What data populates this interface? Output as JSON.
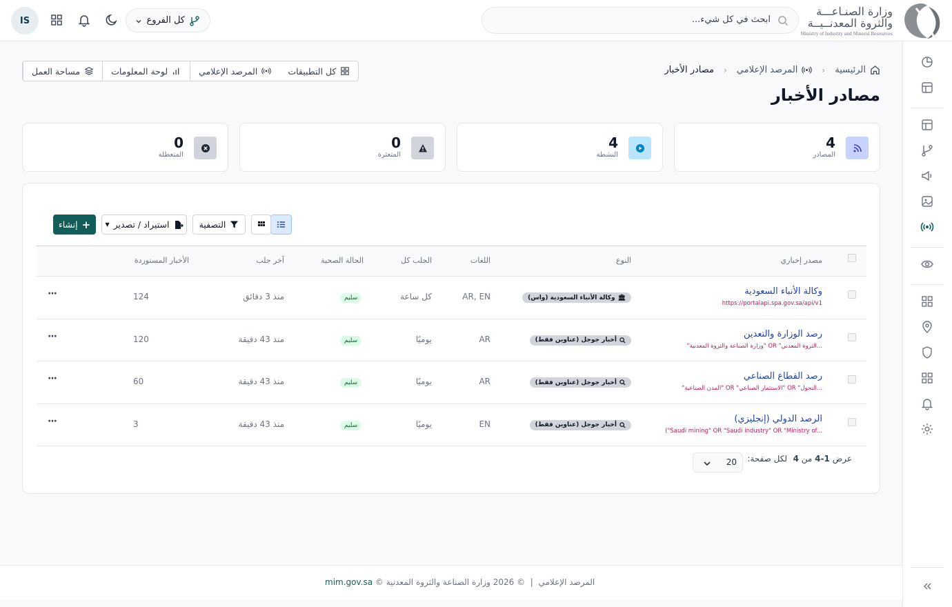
{
  "header": {
    "logo_line1": "وزارة الصنـاعـــة",
    "logo_line2": "والثروة المعدنــيــة",
    "logo_en": "Ministry of Industry and Mineral Resources",
    "search_placeholder": "ابحث في كل شيء...",
    "branch_label": "كل الفروع",
    "avatar_initials": "IS"
  },
  "breadcrumb": {
    "home": "الرئيسية",
    "section": "المرصد الإعلامي",
    "current": "مصادر الأخبار"
  },
  "page_title": "مصادر الأخبار",
  "app_nav": {
    "all_apps": "كل التطبيقات",
    "media_monitor": "المرصد الإعلامي",
    "dashboard": "لوحة المعلومات",
    "workspace": "مساحة العمل"
  },
  "stats": [
    {
      "value": "4",
      "label": "المصادر",
      "color": "#c7d2fe"
    },
    {
      "value": "4",
      "label": "النشطة",
      "color": "#bae6fd"
    },
    {
      "value": "0",
      "label": "المتعثرة",
      "color": "#d1d5db"
    },
    {
      "value": "0",
      "label": "المتعطلة",
      "color": "#d1d5db"
    }
  ],
  "toolbar": {
    "create": "إنشاء",
    "import_export": "استيراد / تصدير",
    "filter": "التصفية"
  },
  "table": {
    "headers": {
      "source": "مصدر إخباري",
      "type": "النوع",
      "languages": "اللغات",
      "fetch_every": "الجلب كل",
      "health": "الحالة الصحية",
      "last_fetch": "آخر جلب",
      "imported": "الأخبار المستوردة"
    },
    "rows": [
      {
        "name": "وكالة الأنباء السعودية",
        "sub": "https://portalapi.spa.gov.sa/api/v1",
        "type": "وكالة الأنباء السعودية (واس)",
        "langs": "AR, EN",
        "every": "كل ساعة",
        "health": "سليم",
        "last": "منذ 3 دقائق",
        "count": "124"
      },
      {
        "name": "رصد الوزارة والتعدين",
        "sub": "\"وزارة الصناعة والثروة المعدنية\" OR \"الثروة المعدني...",
        "type": "أخبار جوجل (عناوين فقط)",
        "langs": "AR",
        "every": "يوميًا",
        "health": "سليم",
        "last": "منذ 43 دقيقة",
        "count": "120"
      },
      {
        "name": "رصد القطاع الصناعي",
        "sub": "\"المدن الصناعية\" OR \"الاستثمار الصناعي\" OR \"التحول...",
        "type": "أخبار جوجل (عناوين فقط)",
        "langs": "AR",
        "every": "يوميًا",
        "health": "سليم",
        "last": "منذ 43 دقيقة",
        "count": "60"
      },
      {
        "name": "الرصد الدولي (إنجليزي)",
        "sub": "(\"Saudi mining\" OR \"Saudi industry\" OR \"Ministry of...",
        "type": "أخبار جوجل (عناوين فقط)",
        "langs": "EN",
        "every": "يوميًا",
        "health": "سليم",
        "last": "منذ 43 دقيقة",
        "count": "3"
      }
    ]
  },
  "pager": {
    "showing_prefix": "عرض",
    "range": "1-4",
    "of": "من",
    "total": "4",
    "per_page_label": "لكل صفحة:",
    "per_page_value": "20"
  },
  "footer": {
    "app_name": "المرصد الإعلامي",
    "separator": "|",
    "copyright": "© 2026 وزارة الصناعة والثروة المعدنية ©",
    "domain": "mim.gov.sa"
  }
}
